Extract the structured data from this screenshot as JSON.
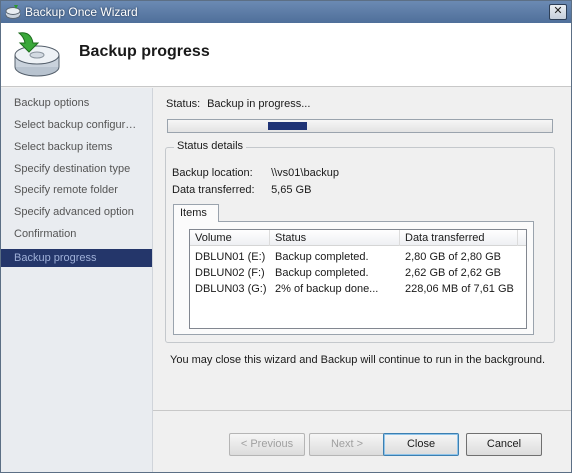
{
  "window": {
    "title": "Backup Once Wizard",
    "close_glyph": "✕"
  },
  "header": {
    "title": "Backup progress",
    "icon": "backup-disk-icon"
  },
  "nav": {
    "items": [
      {
        "label": "Backup options"
      },
      {
        "label": "Select backup configur…"
      },
      {
        "label": "Select backup items"
      },
      {
        "label": "Specify destination type"
      },
      {
        "label": "Specify remote folder"
      },
      {
        "label": "Specify advanced option"
      },
      {
        "label": "Confirmation"
      },
      {
        "label": "Backup progress",
        "active": true
      }
    ]
  },
  "status": {
    "label": "Status:",
    "value": "Backup in progress..."
  },
  "details": {
    "legend": "Status details",
    "location_label": "Backup location:",
    "location_value": "\\\\vs01\\backup",
    "transferred_label": "Data transferred:",
    "transferred_value": "5,65 GB"
  },
  "tab": {
    "label": "Items"
  },
  "items_table": {
    "columns": [
      "Volume",
      "Status",
      "Data transferred"
    ],
    "rows": [
      [
        "DBLUN01 (E:)",
        "Backup completed.",
        "2,80 GB of 2,80 GB"
      ],
      [
        "DBLUN02 (F:)",
        "Backup completed.",
        "2,62 GB of 2,62 GB"
      ],
      [
        "DBLUN03 (G:)",
        "2% of backup done...",
        "228,06 MB of 7,61 GB"
      ]
    ]
  },
  "note": "You may close this wizard and Backup will continue to run in the background.",
  "buttons": {
    "previous": "< Previous",
    "next": "Next >",
    "close": "Close",
    "cancel": "Cancel"
  },
  "colors": {
    "accent": "#24366a",
    "progress": "#1f3375"
  }
}
